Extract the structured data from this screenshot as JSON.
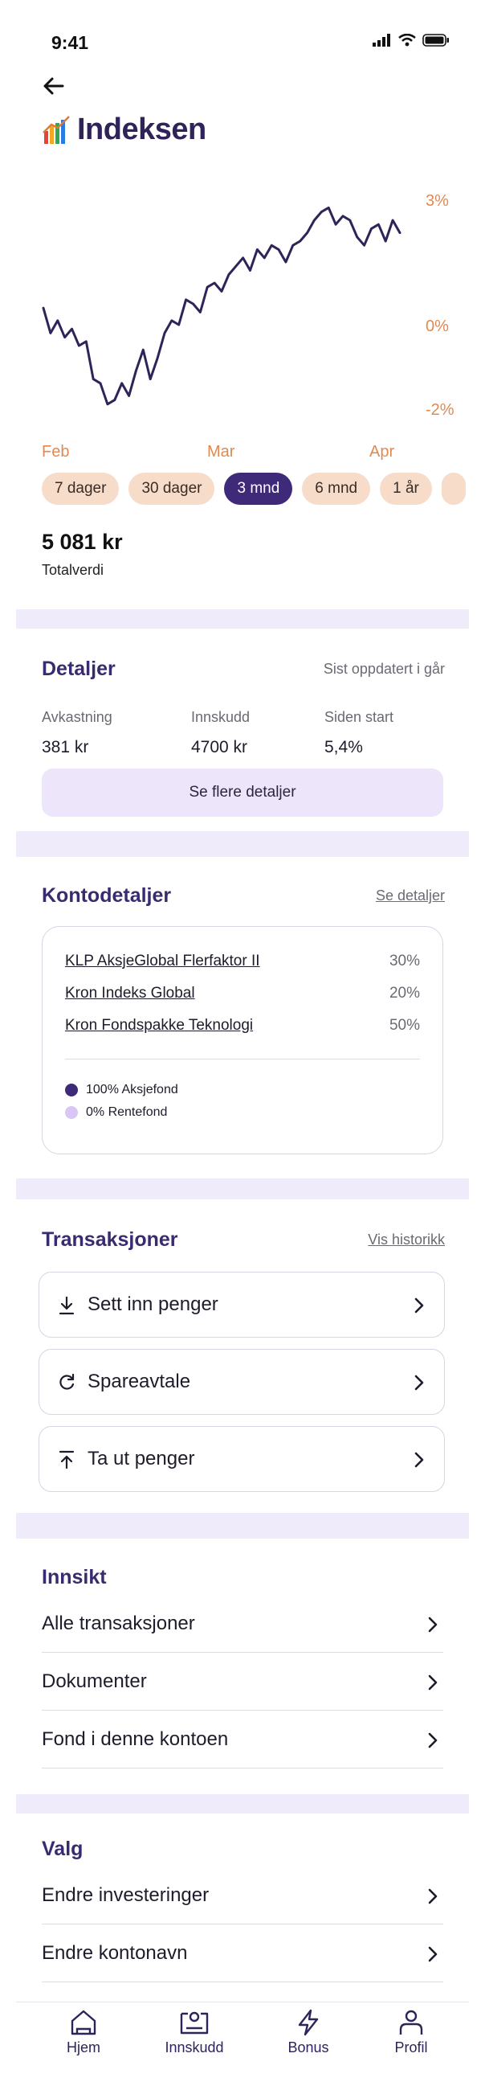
{
  "status_bar": {
    "time": "9:41"
  },
  "header": {
    "title": "Indeksen",
    "back_icon": "arrow-left-icon",
    "logo_icon": "fund-logo-icon"
  },
  "chart_data": {
    "type": "line",
    "x_tick_labels": [
      "Feb",
      "Mar",
      "Apr"
    ],
    "y_tick_labels": [
      "3%",
      "0%",
      "-2%"
    ],
    "ylim": [
      -2,
      3
    ],
    "grid": false,
    "line_color": "#2f2359",
    "tick_color": "#e08a52",
    "x": [
      0,
      2,
      4,
      6,
      8,
      10,
      12,
      14,
      16,
      18,
      20,
      22,
      24,
      26,
      28,
      30,
      32,
      34,
      36,
      38,
      40,
      42,
      44,
      46,
      48,
      50,
      52,
      54,
      56,
      58,
      60,
      62,
      64,
      66,
      68,
      70,
      72,
      74,
      76,
      78,
      80,
      82,
      84,
      86,
      88,
      90,
      92,
      94,
      96,
      98,
      100
    ],
    "values": [
      0.4,
      -0.2,
      0.1,
      -0.3,
      -0.1,
      -0.5,
      -0.4,
      -1.3,
      -1.4,
      -1.9,
      -1.8,
      -1.4,
      -1.7,
      -1.1,
      -0.6,
      -1.3,
      -0.8,
      -0.2,
      0.1,
      0.0,
      0.6,
      0.5,
      0.3,
      0.9,
      1.0,
      0.8,
      1.2,
      1.4,
      1.6,
      1.3,
      1.8,
      1.6,
      1.9,
      1.8,
      1.5,
      1.9,
      2.0,
      2.2,
      2.5,
      2.7,
      2.8,
      2.4,
      2.6,
      2.5,
      2.1,
      1.9,
      2.3,
      2.4,
      2.0,
      2.5,
      2.2
    ]
  },
  "range_chips": [
    {
      "label": "7 dager",
      "active": false
    },
    {
      "label": "30 dager",
      "active": false
    },
    {
      "label": "3 mnd",
      "active": true
    },
    {
      "label": "6 mnd",
      "active": false
    },
    {
      "label": "1 år",
      "active": false
    }
  ],
  "summary": {
    "total_value": "5 081 kr",
    "total_label": "Totalverdi"
  },
  "details": {
    "title": "Detaljer",
    "updated": "Sist oppdatert i går",
    "stats": [
      {
        "label": "Avkastning",
        "value": "381 kr"
      },
      {
        "label": "Innskudd",
        "value": "4700 kr"
      },
      {
        "label": "Siden start",
        "value": "5,4%"
      }
    ],
    "more_button": "Se flere detaljer"
  },
  "account": {
    "title": "Kontodetaljer",
    "link": "Se detaljer",
    "funds": [
      {
        "name": "KLP AksjeGlobal Flerfaktor II",
        "pct": "30%"
      },
      {
        "name": "Kron Indeks Global",
        "pct": "20%"
      },
      {
        "name": "Kron Fondspakke Teknologi",
        "pct": "50%"
      }
    ],
    "legend": [
      {
        "label": "100% Aksjefond",
        "color": "#3e2a78"
      },
      {
        "label": "0% Rentefond",
        "color": "#d8c6f5"
      }
    ]
  },
  "transactions": {
    "title": "Transaksjoner",
    "link": "Vis historikk",
    "actions": [
      {
        "label": "Sett inn penger",
        "icon": "download-icon"
      },
      {
        "label": "Spareavtale",
        "icon": "refresh-icon"
      },
      {
        "label": "Ta ut penger",
        "icon": "upload-icon"
      }
    ]
  },
  "insight": {
    "title": "Innsikt",
    "items": [
      "Alle transaksjoner",
      "Dokumenter",
      "Fond i denne kontoen"
    ]
  },
  "choices": {
    "title": "Valg",
    "items": [
      "Endre investeringer",
      "Endre kontonavn"
    ]
  },
  "tabbar": [
    {
      "label": "Hjem",
      "icon": "home-icon"
    },
    {
      "label": "Innskudd",
      "icon": "deposit-icon"
    },
    {
      "label": "Bonus",
      "icon": "lightning-icon"
    },
    {
      "label": "Profil",
      "icon": "profile-icon"
    }
  ],
  "colors": {
    "accent": "#3e2a78",
    "lilac": "#ede6fa",
    "peach": "#f6dcc9",
    "orange": "#e08a52"
  }
}
